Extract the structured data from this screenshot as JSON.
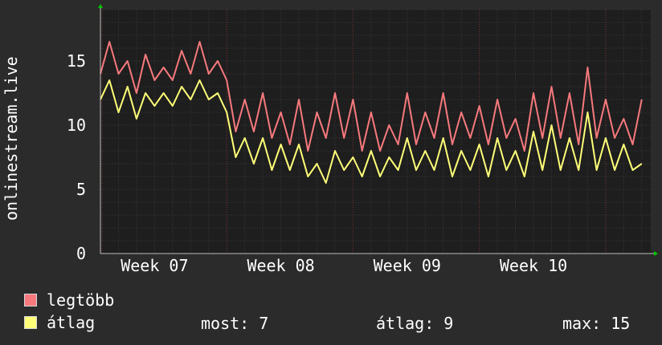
{
  "chart_data": {
    "type": "line",
    "ylabel": "onlinestream.live",
    "xlabel": "",
    "title": "",
    "ylim": [
      0,
      19
    ],
    "yticks": [
      0,
      5,
      10,
      15
    ],
    "x_range": [
      0,
      30.5
    ],
    "x_unit": "days",
    "xticks": [
      {
        "label": "Week 07",
        "x": 3
      },
      {
        "label": "Week 08",
        "x": 10
      },
      {
        "label": "Week 09",
        "x": 17
      },
      {
        "label": "Week 10",
        "x": 24
      }
    ],
    "week_boundaries": [
      7,
      14,
      21,
      28
    ],
    "grid": true,
    "series": [
      {
        "name": "legtöbb",
        "color": "#f7797d",
        "x": [
          0,
          0.5,
          1,
          1.5,
          2,
          2.5,
          3,
          3.5,
          4,
          4.5,
          5,
          5.5,
          6,
          6.5,
          7,
          7.5,
          8,
          8.5,
          9,
          9.5,
          10,
          10.5,
          11,
          11.5,
          12,
          12.5,
          13,
          13.5,
          14,
          14.5,
          15,
          15.5,
          16,
          16.5,
          17,
          17.5,
          18,
          18.5,
          19,
          19.5,
          20,
          20.5,
          21,
          21.5,
          22,
          22.5,
          23,
          23.5,
          24,
          24.5,
          25,
          25.5,
          26,
          26.5,
          27,
          27.5,
          28,
          28.5,
          29,
          29.5,
          30
        ],
        "values": [
          14,
          16.5,
          14,
          15,
          12.5,
          15.5,
          13.5,
          14.5,
          13.5,
          15.8,
          14,
          16.5,
          14,
          15,
          13.5,
          9.5,
          12,
          9.5,
          12.5,
          9,
          11,
          8.5,
          12,
          8,
          11,
          9,
          12.5,
          9,
          12,
          8,
          11,
          8,
          10,
          8.5,
          12.5,
          8.5,
          11,
          9,
          12.5,
          8.5,
          11,
          9,
          11.5,
          8.5,
          12,
          9,
          10.5,
          8,
          12.5,
          9,
          13,
          9,
          12.5,
          8.5,
          14.5,
          9,
          12,
          9,
          10.5,
          8.5,
          12
        ]
      },
      {
        "name": "átlag",
        "color": "#ffff78",
        "x": [
          0,
          0.5,
          1,
          1.5,
          2,
          2.5,
          3,
          3.5,
          4,
          4.5,
          5,
          5.5,
          6,
          6.5,
          7,
          7.5,
          8,
          8.5,
          9,
          9.5,
          10,
          10.5,
          11,
          11.5,
          12,
          12.5,
          13,
          13.5,
          14,
          14.5,
          15,
          15.5,
          16,
          16.5,
          17,
          17.5,
          18,
          18.5,
          19,
          19.5,
          20,
          20.5,
          21,
          21.5,
          22,
          22.5,
          23,
          23.5,
          24,
          24.5,
          25,
          25.5,
          26,
          26.5,
          27,
          27.5,
          28,
          28.5,
          29,
          29.5,
          30
        ],
        "values": [
          12,
          13.5,
          11,
          13,
          10.5,
          12.5,
          11.5,
          12.5,
          11.5,
          13,
          12,
          13.5,
          12,
          12.5,
          11,
          7.5,
          9,
          7,
          9,
          6.5,
          8.5,
          6.5,
          8.5,
          6,
          7,
          5.5,
          8,
          6.5,
          7.5,
          6,
          8,
          6,
          7.5,
          6.5,
          9,
          6.5,
          8,
          6.5,
          9,
          6,
          8,
          6.5,
          8.5,
          6,
          9,
          6.5,
          8,
          6,
          9.5,
          6.5,
          10,
          6.5,
          9,
          6.5,
          11,
          6.5,
          9,
          6.5,
          8.5,
          6.5,
          7
        ]
      }
    ]
  },
  "legend": [
    {
      "label": "legtöbb",
      "color": "#f7797d"
    },
    {
      "label": "átlag",
      "color": "#ffff78"
    }
  ],
  "stats": {
    "most": "most: 7",
    "atlag": "átlag: 9",
    "max": "max: 15"
  },
  "colors": {
    "background": "#2b2b2b",
    "plot_background": "#1e1e1e",
    "grid": "#3a3a3a",
    "boundary": "#7a3232",
    "arrow": "#00c800"
  }
}
